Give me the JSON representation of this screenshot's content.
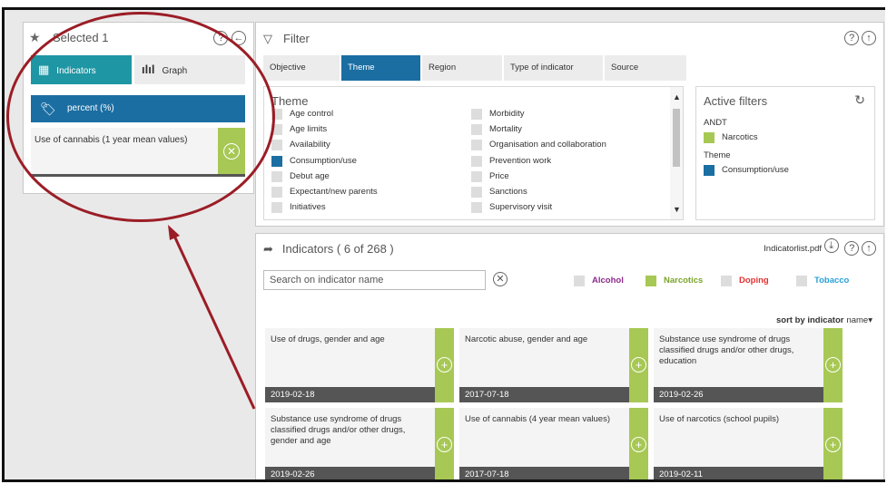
{
  "selected": {
    "title": "Selected 1",
    "help_icon": "?",
    "back_icon": "←",
    "tabs": [
      {
        "label": "Indicators",
        "icon": "grid-icon"
      },
      {
        "label": "Graph",
        "icon": "chart-icon"
      }
    ],
    "unit_label": "percent (%)",
    "item": "Use of cannabis (1 year mean values)"
  },
  "filter": {
    "title": "Filter",
    "tabs": [
      "Objective",
      "Theme",
      "Region",
      "Type of indicator",
      "Source"
    ],
    "active_tab": "Theme",
    "theme_title": "Theme",
    "theme_col1": [
      "Age control",
      "Age limits",
      "Availability",
      "Consumption/use",
      "Debut age",
      "Expectant/new parents",
      "Initiatives"
    ],
    "theme_col2": [
      "Morbidity",
      "Mortality",
      "Organisation and collaboration",
      "Prevention work",
      "Price",
      "Sanctions",
      "Supervisory visit"
    ],
    "checked": "Consumption/use",
    "active_filters": {
      "title": "Active filters",
      "group1": "ANDT",
      "item1": "Narcotics",
      "group2": "Theme",
      "item2": "Consumption/use"
    }
  },
  "indicators": {
    "title": "Indicators ( 6 of 268 )",
    "pdf_label": "Indicatorlist.pdf",
    "search_placeholder": "Search on indicator name",
    "categories": [
      {
        "label": "Alcohol",
        "color": "#8a2a8c",
        "on": false
      },
      {
        "label": "Narcotics",
        "color": "#7aa42a",
        "on": true
      },
      {
        "label": "Doping",
        "color": "#e3312f",
        "on": false
      },
      {
        "label": "Tobacco",
        "color": "#2aa0d6",
        "on": false
      }
    ],
    "sort_label": "sort by indicator",
    "sort_value": "name▾",
    "cards": [
      {
        "title": "Use of drugs, gender and age",
        "date": "2019-02-18"
      },
      {
        "title": "Narcotic abuse, gender and age",
        "date": "2017-07-18"
      },
      {
        "title": "Substance use syndrome of drugs classified drugs and/or other drugs, education",
        "date": "2019-02-26"
      },
      {
        "title": "Substance use syndrome of drugs classified drugs and/or other drugs, gender and age",
        "date": "2019-02-26"
      },
      {
        "title": "Use of cannabis (4 year mean values)",
        "date": "2017-07-18"
      },
      {
        "title": "Use of narcotics (school pupils)",
        "date": "2019-02-11"
      }
    ]
  },
  "colors": {
    "teal": "#1f96a3",
    "blue": "#1b6ea2",
    "green": "#a7c854",
    "annotation": "#9b1d26"
  }
}
